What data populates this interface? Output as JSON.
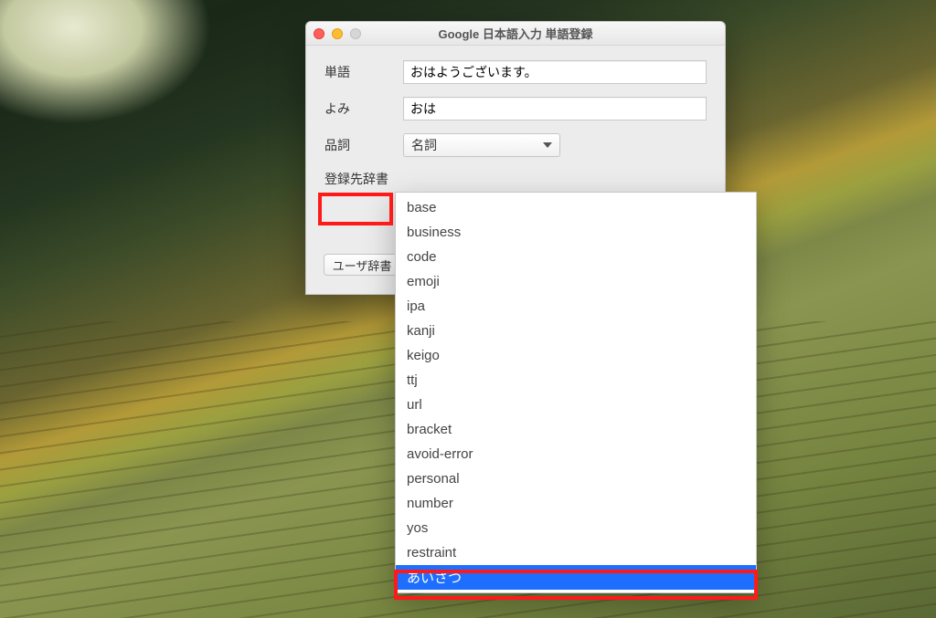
{
  "window": {
    "title": "Google 日本語入力 単語登録"
  },
  "form": {
    "word_label": "単語",
    "word_value": "おはようございます。",
    "yomi_label": "よみ",
    "yomi_value": "おは",
    "pos_label": "品詞",
    "pos_value": "名詞",
    "dict_label": "登録先辞書",
    "user_dict_button": "ユーザ辞書"
  },
  "dropdown": {
    "items": [
      "base",
      "business",
      "code",
      "emoji",
      "ipa",
      "kanji",
      "keigo",
      "ttj",
      "url",
      "bracket",
      "avoid-error",
      "personal",
      "number",
      "yos",
      "restraint",
      "あいさつ"
    ],
    "selected_index": 15
  }
}
